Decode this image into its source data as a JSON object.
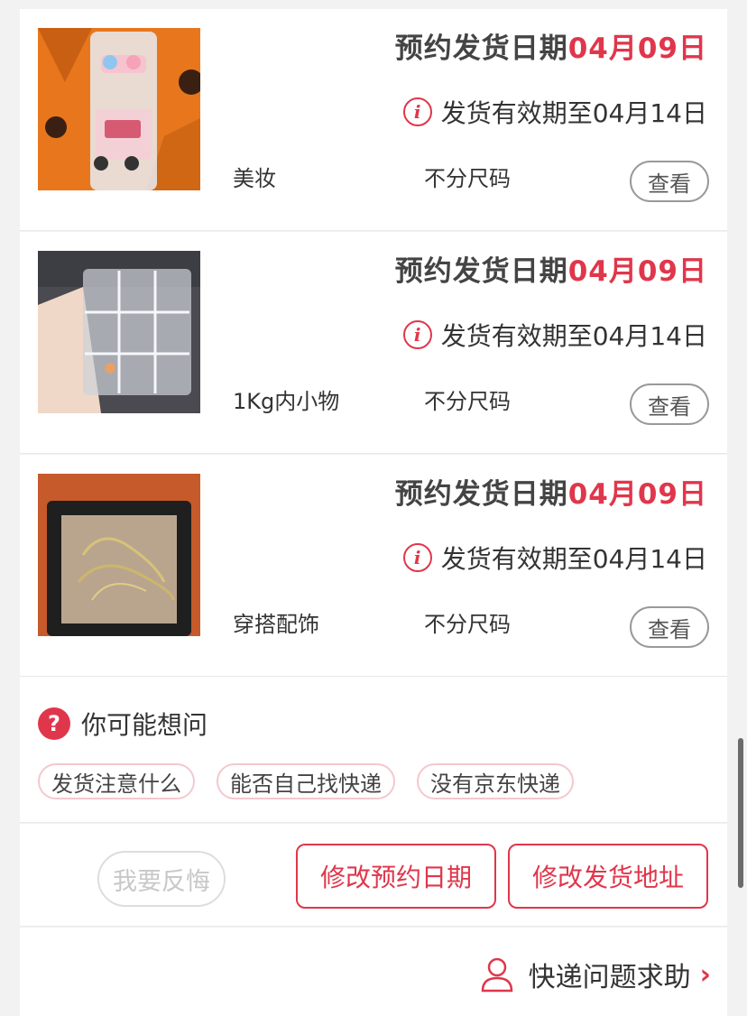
{
  "items": [
    {
      "date_prefix": "预约发货日期",
      "date_value": "04月09日",
      "valid_text": "发货有效期至04月14日",
      "category": "美妆",
      "size": "不分尺码",
      "view_label": "查看",
      "image": "makeup-box-photo"
    },
    {
      "date_prefix": "预约发货日期",
      "date_value": "04月09日",
      "valid_text": "发货有效期至04月14日",
      "category": "1Kg内小物",
      "size": "不分尺码",
      "view_label": "查看",
      "image": "acrylic-organizer-photo"
    },
    {
      "date_prefix": "预约发货日期",
      "date_value": "04月09日",
      "valid_text": "发货有效期至04月14日",
      "category": "穿搭配饰",
      "size": "不分尺码",
      "view_label": "查看",
      "image": "jewelry-box-photo"
    }
  ],
  "icons": {
    "info": "i",
    "question": "?"
  },
  "faq": {
    "title": "你可能想问",
    "chips": [
      "发货注意什么",
      "能否自己找快递",
      "没有京东快递"
    ]
  },
  "actions": {
    "regret": "我要反悔",
    "modify_date": "修改预约日期",
    "modify_address": "修改发货地址"
  },
  "help": {
    "label": "快递问题求助",
    "chevron": "›"
  },
  "colors": {
    "accent": "#e0364b",
    "background": "#f2f2f2"
  }
}
